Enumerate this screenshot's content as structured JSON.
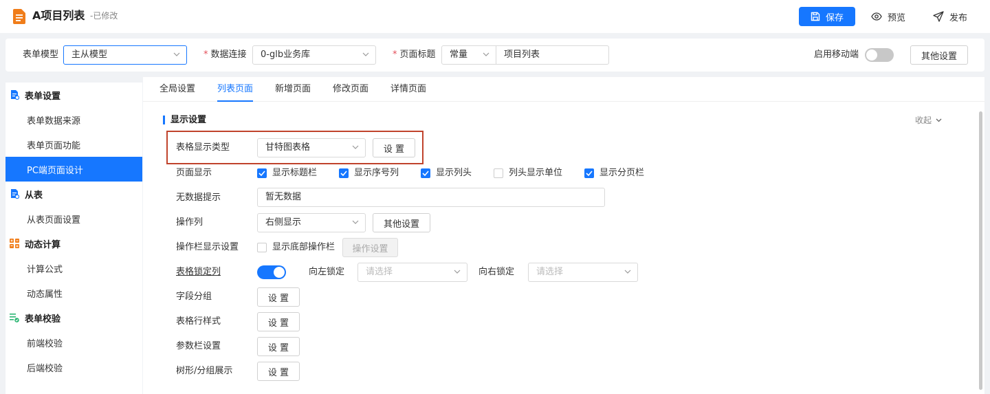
{
  "header": {
    "title": "A项目列表",
    "status": "-已修改",
    "save_label": "保存",
    "preview_label": "预览",
    "publish_label": "发布",
    "colors": {
      "accent": "#1677ff",
      "logo": "#f07d1a"
    }
  },
  "config": {
    "form_model_label": "表单模型",
    "form_model_value": "主从模型",
    "data_conn_label": "数据连接",
    "data_conn_value": "0-glb业务库",
    "page_title_label": "页面标题",
    "page_title_type": "常量",
    "page_title_value": "项目列表",
    "mobile_label": "启用移动端",
    "mobile_enabled": false,
    "other_settings_label": "其他设置"
  },
  "sidebar": {
    "groups": [
      {
        "label": "表单设置",
        "icon": "form-settings-icon",
        "items": [
          "表单数据来源",
          "表单页面功能",
          "PC端页面设计"
        ]
      },
      {
        "label": "从表",
        "icon": "subtable-icon",
        "items": [
          "从表页面设置"
        ]
      },
      {
        "label": "动态计算",
        "icon": "calc-icon",
        "items": [
          "计算公式",
          "动态属性"
        ]
      },
      {
        "label": "表单校验",
        "icon": "validate-icon",
        "items": [
          "前端校验",
          "后端校验"
        ]
      }
    ],
    "active_item": "PC端页面设计"
  },
  "tabs": [
    "全局设置",
    "列表页面",
    "新增页面",
    "修改页面",
    "详情页面"
  ],
  "active_tab": "列表页面",
  "section": {
    "title": "显示设置",
    "collapse_label": "收起",
    "table_type_label": "表格显示类型",
    "table_type_value": "甘特图表格",
    "set_button": "设 置",
    "page_display_label": "页面显示",
    "page_display_options": [
      {
        "label": "显示标题栏",
        "checked": true
      },
      {
        "label": "显示序号列",
        "checked": true
      },
      {
        "label": "显示列头",
        "checked": true
      },
      {
        "label": "列头显示单位",
        "checked": false
      },
      {
        "label": "显示分页栏",
        "checked": true
      }
    ],
    "no_data_label": "无数据提示",
    "no_data_value": "暂无数据",
    "action_col_label": "操作列",
    "action_col_value": "右侧显示",
    "action_col_other": "其他设置",
    "action_bar_label": "操作栏显示设置",
    "action_bar_checkbox": "显示底部操作栏",
    "action_bar_checked": false,
    "action_bar_button": "操作设置",
    "lock_col_label": "表格锁定列",
    "lock_enabled": true,
    "lock_left_label": "向左锁定",
    "lock_left_placeholder": "请选择",
    "lock_right_label": "向右锁定",
    "lock_right_placeholder": "请选择",
    "field_group_label": "字段分组",
    "row_style_label": "表格行样式",
    "param_bar_label": "参数栏设置",
    "tree_group_label": "树形/分组展示"
  }
}
